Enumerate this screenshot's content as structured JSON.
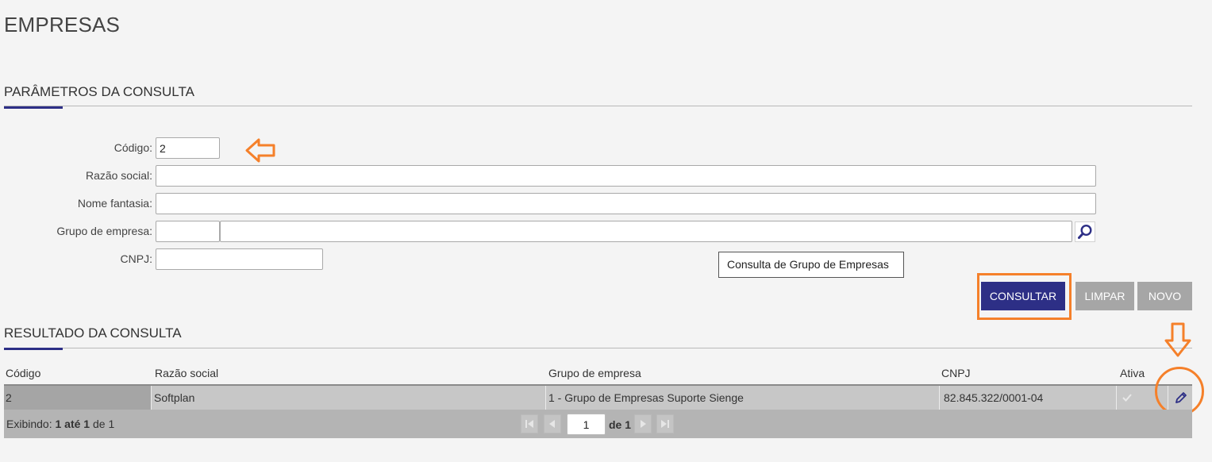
{
  "page": {
    "title": "EMPRESAS"
  },
  "params": {
    "title": "PARÂMETROS DA CONSULTA",
    "codigo_label": "Código:",
    "codigo_value": "2",
    "razao_label": "Razão social:",
    "razao_value": "",
    "fantasia_label": "Nome fantasia:",
    "fantasia_value": "",
    "grupo_label": "Grupo de empresa:",
    "grupo_code_value": "",
    "grupo_name_value": "",
    "cnpj_label": "CNPJ:",
    "cnpj_value": "",
    "tooltip": "Consulta de Grupo de Empresas"
  },
  "actions": {
    "consultar": "CONSULTAR",
    "limpar": "LIMPAR",
    "novo": "NOVO"
  },
  "results": {
    "title": "RESULTADO DA CONSULTA",
    "columns": [
      "Código",
      "Razão social",
      "Grupo de empresa",
      "CNPJ",
      "Ativa"
    ],
    "rows": [
      {
        "codigo": "2",
        "razao": "Softplan",
        "grupo": "1 - Grupo de Empresas Suporte Sienge",
        "cnpj": "82.845.322/0001-04",
        "ativa": true
      }
    ]
  },
  "pager": {
    "prefix": "Exibindo:",
    "from": "1",
    "ate": "até",
    "to": "1",
    "de": "de",
    "total": "1",
    "page_value": "1",
    "of_label": "de 1"
  },
  "colors": {
    "primary": "#2d2f86",
    "highlight": "#f5802a"
  },
  "icons": [
    "arrow-left-icon",
    "search-icon",
    "arrow-down-icon",
    "pencil-icon",
    "checkmark-icon",
    "first-page-icon",
    "prev-page-icon",
    "next-page-icon",
    "last-page-icon"
  ]
}
